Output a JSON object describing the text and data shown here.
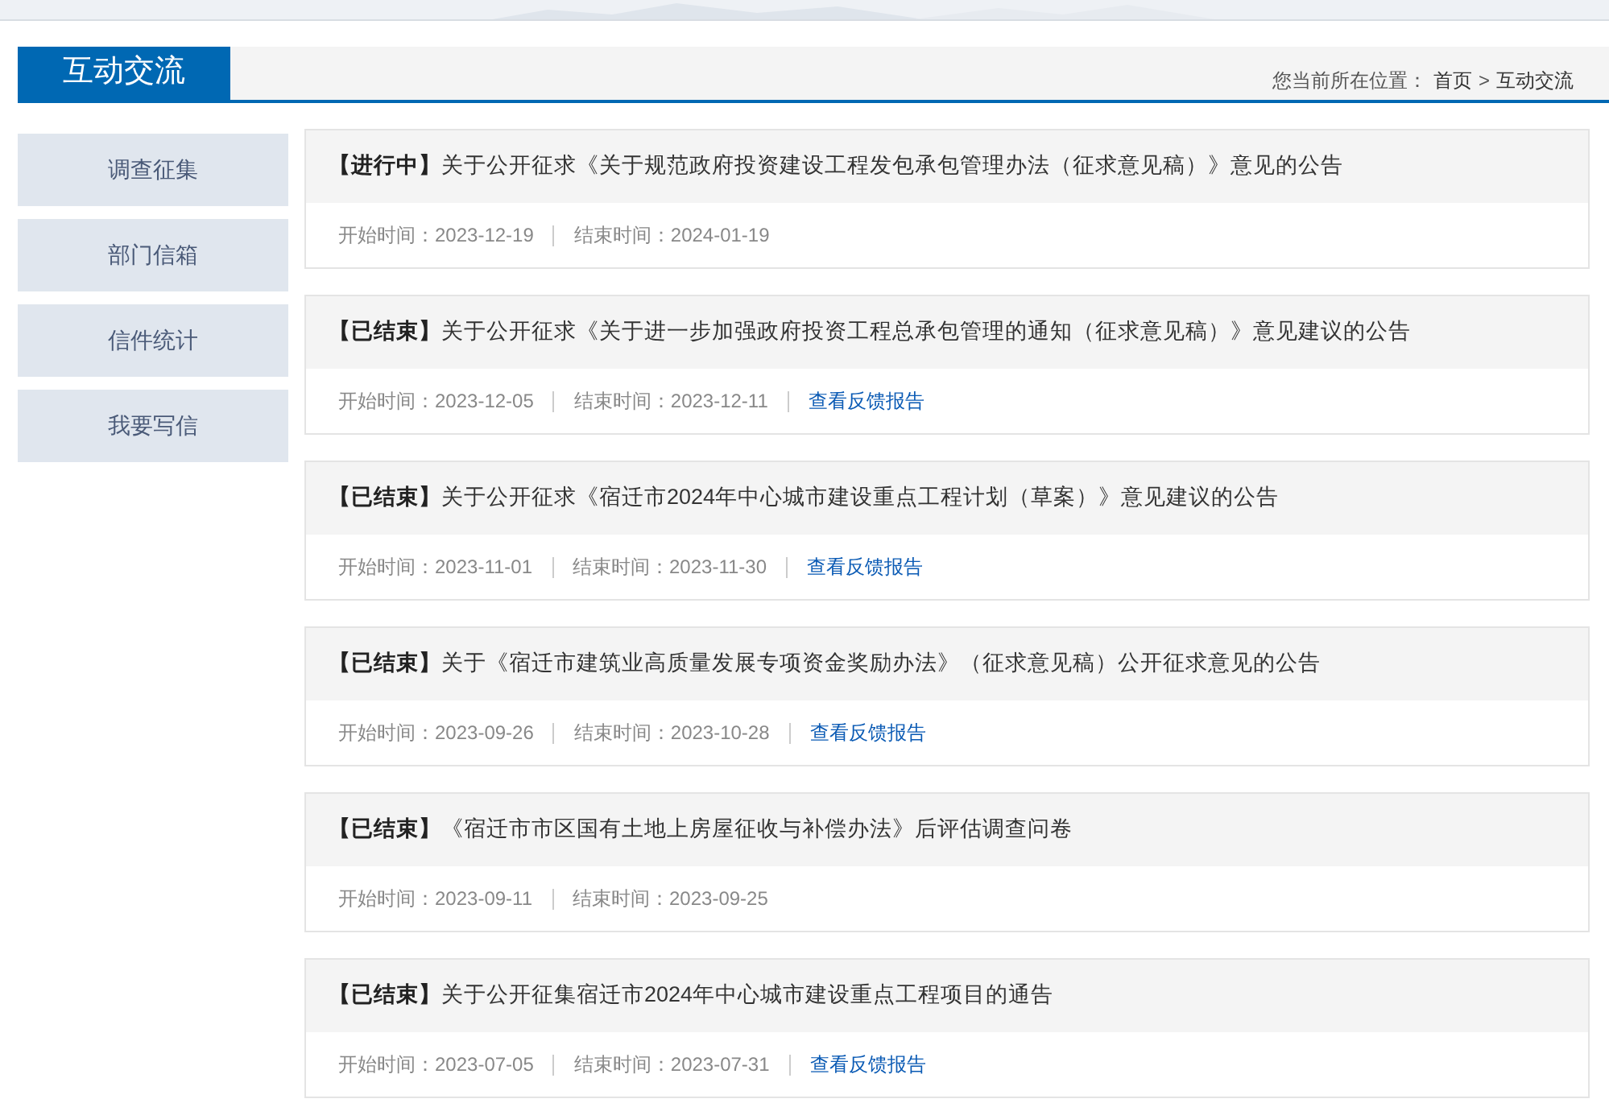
{
  "header": {
    "title": "互动交流",
    "breadcrumb": {
      "label": "您当前所在位置：",
      "links": [
        "首页",
        "互动交流"
      ],
      "separator": ">"
    }
  },
  "sidebar": {
    "items": [
      {
        "label": "调查征集",
        "selected": false
      },
      {
        "label": "部门信箱",
        "selected": false
      },
      {
        "label": "信件统计",
        "selected": false
      },
      {
        "label": "我要写信",
        "selected": false
      }
    ]
  },
  "notices": [
    {
      "status": "【进行中】",
      "title": "关于公开征求《关于规范政府投资建设工程发包承包管理办法（征求意见稿）》意见的公告",
      "start": "开始时间：2023-12-19",
      "end": "结束时间：2024-01-19"
    },
    {
      "status": "【已结束】",
      "title": "关于公开征求《关于进一步加强政府投资工程总承包管理的通知（征求意见稿）》意见建议的公告",
      "start": "开始时间：2023-12-05",
      "end": "结束时间：2023-12-11",
      "report": "查看反馈报告"
    },
    {
      "status": "【已结束】",
      "title": "关于公开征求《宿迁市2024年中心城市建设重点工程计划（草案）》意见建议的公告",
      "start": "开始时间：2023-11-01",
      "end": "结束时间：2023-11-30",
      "report": "查看反馈报告"
    },
    {
      "status": "【已结束】",
      "title": "关于《宿迁市建筑业高质量发展专项资金奖励办法》（征求意见稿）公开征求意见的公告",
      "start": "开始时间：2023-09-26",
      "end": "结束时间：2023-10-28",
      "report": "查看反馈报告"
    },
    {
      "status": "【已结束】",
      "title": "《宿迁市市区国有土地上房屋征收与补偿办法》后评估调查问卷",
      "start": "开始时间：2023-09-11",
      "end": "结束时间：2023-09-25"
    },
    {
      "status": "【已结束】",
      "title": "关于公开征集宿迁市2024年中心城市建设重点工程项目的通告",
      "start": "开始时间：2023-07-05",
      "end": "结束时间：2023-07-31",
      "report": "查看反馈报告"
    }
  ]
}
